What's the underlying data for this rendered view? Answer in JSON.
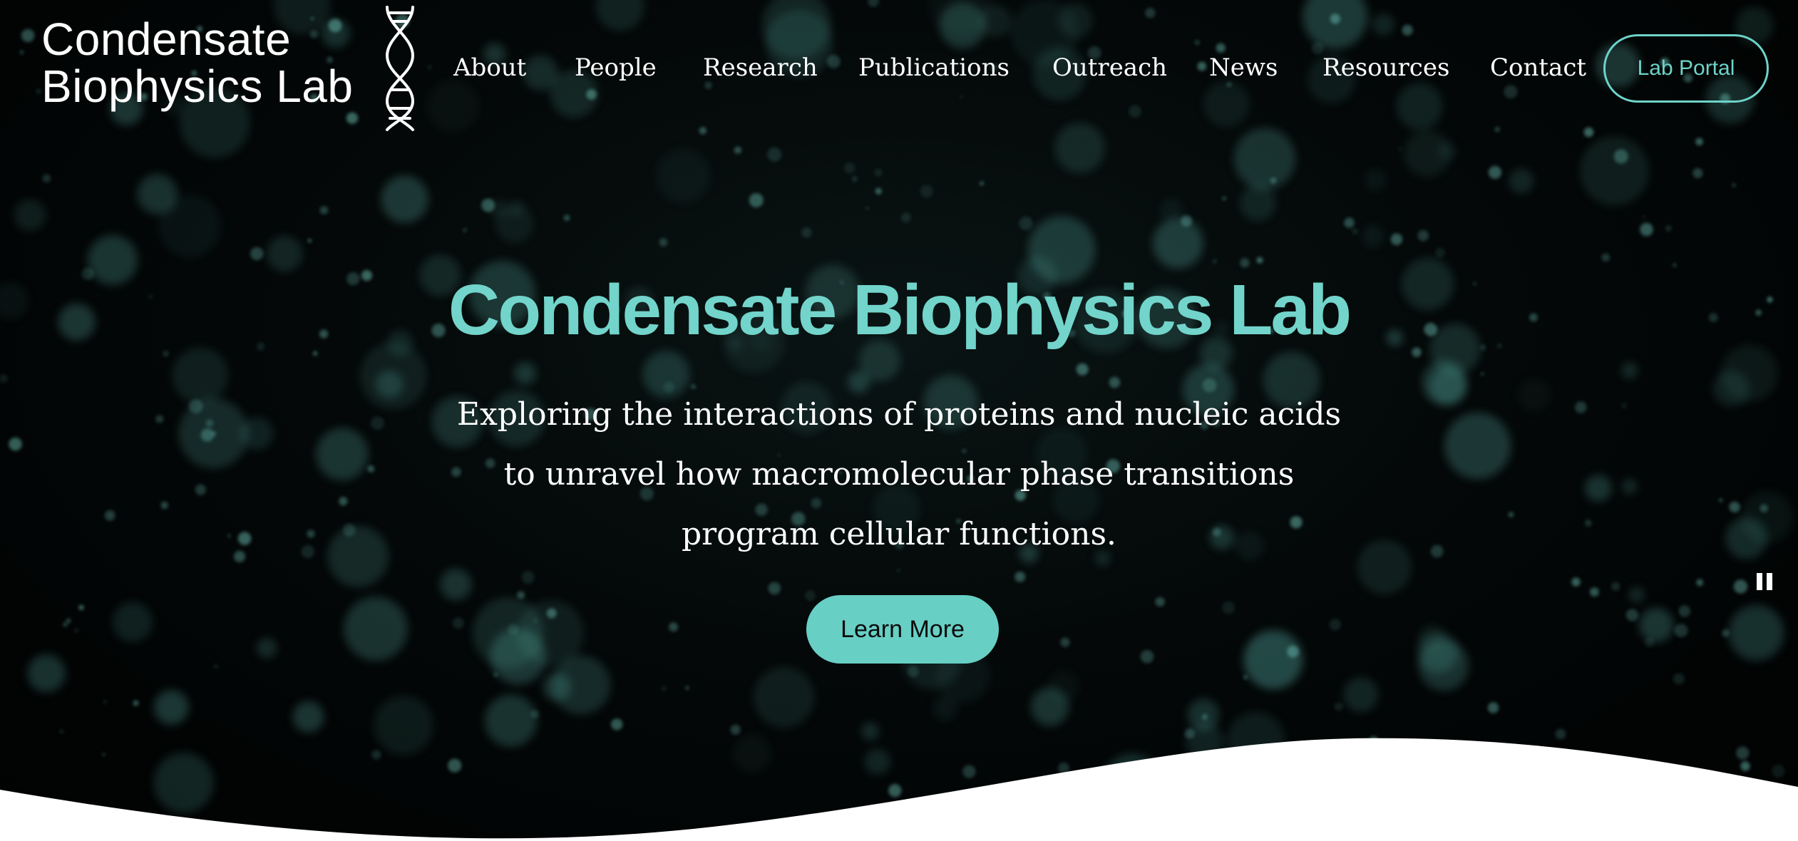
{
  "header": {
    "logo_line1": "Condensate",
    "logo_line2": "Biophysics Lab",
    "logo_icon": "dna-helix-icon",
    "nav": [
      {
        "label": "About"
      },
      {
        "label": "People"
      },
      {
        "label": "Research"
      },
      {
        "label": "Publications"
      },
      {
        "label": "Outreach"
      },
      {
        "label": "News"
      },
      {
        "label": "Resources"
      },
      {
        "label": "Contact"
      }
    ],
    "portal_label": "Lab Portal"
  },
  "hero": {
    "title": "Condensate Biophysics Lab",
    "subtitle_lines": [
      "Exploring the interactions of proteins and nucleic acids",
      "to unravel how macromolecular phase transitions",
      "program cellular functions."
    ],
    "cta_label": "Learn More",
    "pause_icon": "pause-icon"
  },
  "colors": {
    "accent": "#72d4ca",
    "button_fill": "#68cfc5",
    "background": "#020404",
    "wave": "#ffffff"
  }
}
